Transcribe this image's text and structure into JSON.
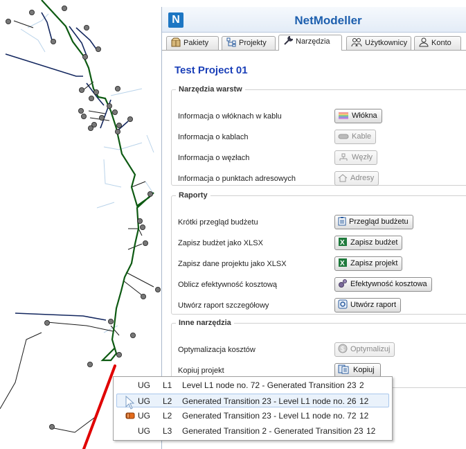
{
  "app": {
    "title": "NetModeller",
    "logo_letter": "N"
  },
  "tabs": [
    {
      "label": "Pakiety",
      "icon": "package-icon"
    },
    {
      "label": "Projekty",
      "icon": "project-tree-icon"
    },
    {
      "label": "Narzędzia",
      "icon": "wrench-icon",
      "active": true
    },
    {
      "label": "Użytkownicy",
      "icon": "users-icon"
    },
    {
      "label": "Konto",
      "icon": "user-icon"
    }
  ],
  "project_title": "Test Project 01",
  "sections": {
    "layers": {
      "title": "Narzędzia warstw",
      "rows": [
        {
          "label": "Informacja o włóknach w kablu",
          "button": "Włókna",
          "icon": "fibers-icon",
          "enabled": true
        },
        {
          "label": "Informacja o kablach",
          "button": "Kable",
          "icon": "cable-icon",
          "enabled": false
        },
        {
          "label": "Informacja o węzłach",
          "button": "Węzły",
          "icon": "nodes-icon",
          "enabled": false
        },
        {
          "label": "Informacja o punktach adresowych",
          "button": "Adresy",
          "icon": "house-icon",
          "enabled": false
        }
      ]
    },
    "reports": {
      "title": "Raporty",
      "rows": [
        {
          "label": "Krótki przegląd budżetu",
          "button": "Przegląd budżetu",
          "icon": "clipboard-icon",
          "enabled": true
        },
        {
          "label": "Zapisz budżet jako XLSX",
          "button": "Zapisz budżet",
          "icon": "excel-icon",
          "enabled": true
        },
        {
          "label": "Zapisz dane projektu jako XLSX",
          "button": "Zapisz projekt",
          "icon": "excel-icon",
          "enabled": true
        },
        {
          "label": "Oblicz efektywność kosztową",
          "button": "Efektywność kosztowa",
          "icon": "gears-icon",
          "enabled": true
        },
        {
          "label": "Utwórz raport szczegółowy",
          "button": "Utwórz raport",
          "icon": "gear-icon",
          "enabled": true
        }
      ]
    },
    "other": {
      "title": "Inne narzędzia",
      "rows": [
        {
          "label": "Optymalizacja kosztów",
          "button": "Optymalizuj",
          "icon": "dollar-icon",
          "enabled": false
        },
        {
          "label": "Kopiuj projekt",
          "button": "Kopiuj",
          "icon": "copy-icon",
          "enabled": true
        }
      ]
    }
  },
  "popup": {
    "rows": [
      {
        "type": "UG",
        "level": "L1",
        "name": "Level L1 node no. 72 - Generated Transition 23",
        "count": "2"
      },
      {
        "type": "UG",
        "level": "L2",
        "name": "Generated Transition 23 - Level L1 node no. 26",
        "count": "12",
        "selected": true
      },
      {
        "type": "UG",
        "level": "L2",
        "name": "Generated Transition 23 - Level L1 node no. 72",
        "count": "12"
      },
      {
        "type": "UG",
        "level": "L3",
        "name": "Generated Transition 2 - Generated Transition 23",
        "count": "12"
      }
    ]
  },
  "colors": {
    "brand": "#1d76c3",
    "title_blue": "#1d5fae",
    "project_title": "#1a3fb8",
    "trunk_line": "#0d5a12",
    "feeder_line": "#12265e",
    "highlight_arrow": "#e00000"
  }
}
